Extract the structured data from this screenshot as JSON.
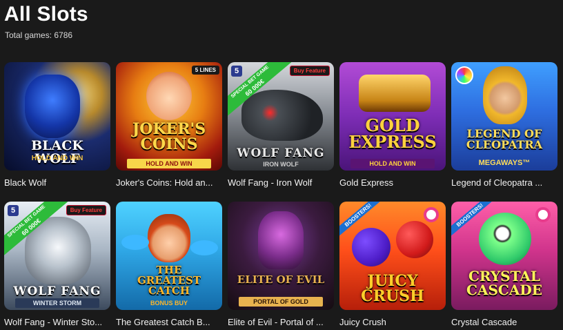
{
  "header": {
    "title": "All Slots",
    "total": "Total games: 6786"
  },
  "games": [
    {
      "name": "Black Wolf",
      "logo": "BLACK WOLF",
      "sub": "HOLD AND WIN"
    },
    {
      "name": "Joker's Coins: Hold an...",
      "logo": "JOKER'S COINS",
      "sub": "HOLD AND WIN",
      "corner": "5 LINES"
    },
    {
      "name": "Wolf Fang - Iron Wolf",
      "logo": "WOLF FANG",
      "sub": "IRON WOLF",
      "ribbon_top": "SPECIAL BET GAME",
      "ribbon_bottom": "60 000€",
      "corner": "Buy Feature",
      "badge": "5"
    },
    {
      "name": "Gold Express",
      "logo": "GOLD EXPRESS",
      "sub": "HOLD AND WIN"
    },
    {
      "name": "Legend of Cleopatra ...",
      "logo": "LEGEND OF CLEOPATRA",
      "sub": "MEGAWAYS™"
    },
    {
      "name": "Wolf Fang - Winter Sto...",
      "logo": "WOLF FANG",
      "sub": "WINTER STORM",
      "ribbon_top": "SPECIAL BET GAME",
      "ribbon_bottom": "60 000€",
      "corner": "Buy Feature",
      "badge": "5"
    },
    {
      "name": "The Greatest Catch B...",
      "logo": "THE GREATEST CATCH",
      "sub": "BONUS BUY"
    },
    {
      "name": "Elite of Evil - Portal of ...",
      "logo": "ELITE OF EVIL",
      "sub": "PORTAL OF GOLD"
    },
    {
      "name": "Juicy Crush",
      "logo": "JUICY CRUSH",
      "boost": "BOOSTERS!"
    },
    {
      "name": "Crystal Cascade",
      "logo": "CRYSTAL CASCADE",
      "boost": "BOOSTERS!"
    }
  ],
  "colors": {
    "background": "#1a1a1a",
    "ribbon": "#2dbb3a",
    "buy_feature": "#c8102e"
  }
}
